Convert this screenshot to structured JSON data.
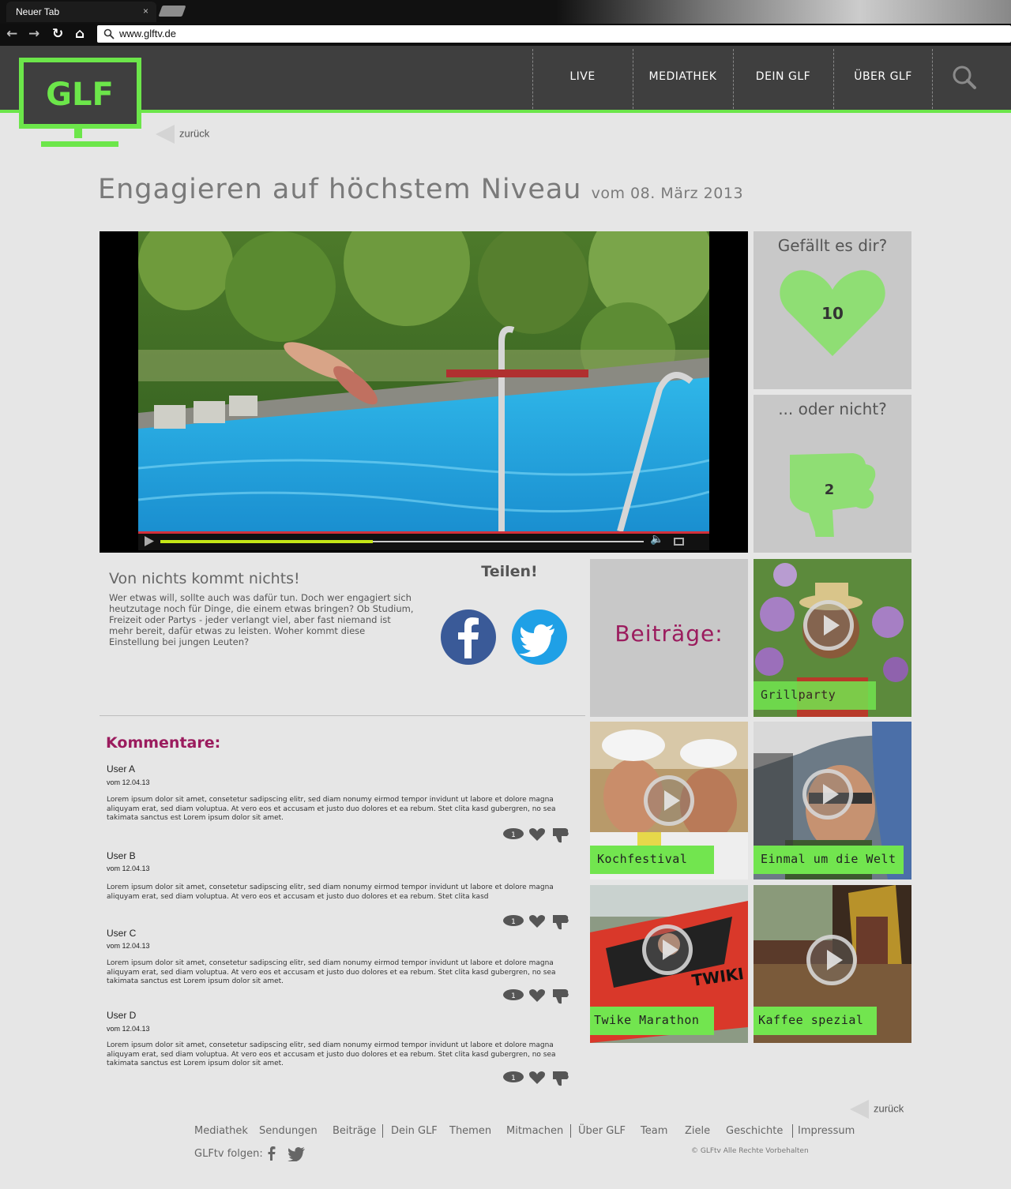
{
  "browser": {
    "tab_title": "Neuer Tab",
    "tab_close": "×",
    "url": "www.glftv.de"
  },
  "site": {
    "logo_text": "GLF",
    "nav": [
      "LIVE",
      "MEDIATHEK",
      "DEIN GLF",
      "ÜBER GLF"
    ],
    "back_label": "zurück",
    "accent_color": "#6ce64a",
    "header_color": "#3f3f3f",
    "comment_heading_color": "#9b1c5e"
  },
  "article": {
    "title": "Engagieren auf höchstem Niveau",
    "date": "vom 08. März 2013",
    "video_progress": 0.44
  },
  "rating": {
    "like_question": "Gefällt es dir?",
    "like_count": "10",
    "dislike_question": "... oder nicht?",
    "dislike_count": "2"
  },
  "description": {
    "heading": "Von nichts kommt nichts!",
    "text": "Wer etwas will, sollte auch was dafür tun. Doch wer engagiert sich heutzutage noch für Dinge, die einem etwas bringen? Ob Studium, Freizeit oder Partys - jeder verlangt viel, aber fast niemand ist mehr bereit, dafür etwas zu leisten. Woher kommt diese Einstellung bei jungen Leuten?"
  },
  "share": {
    "heading": "Teilen!",
    "icons": [
      "facebook-icon",
      "twitter-icon"
    ]
  },
  "beitraege": {
    "heading": "Beiträge:",
    "tiles": [
      "Grillparty",
      "Kochfestival",
      "Einmal um die Welt",
      "Twike Marathon",
      "Kaffee spezial"
    ]
  },
  "comments": {
    "heading": "Kommentare:",
    "items": [
      {
        "user": "User A",
        "date": "vom 12.04.13",
        "text": "Lorem ipsum dolor sit amet, consetetur sadipscing elitr, sed diam nonumy eirmod tempor invidunt ut labore et dolore magna aliquyam erat, sed diam voluptua. At vero eos et accusam et justo duo dolores et ea rebum. Stet clita kasd gubergren, no sea takimata sanctus est Lorem ipsum dolor sit amet.",
        "count": "1"
      },
      {
        "user": "User B",
        "date": "vom 12.04.13",
        "text": "Lorem ipsum dolor sit amet, consetetur sadipscing elitr, sed diam nonumy eirmod tempor invidunt ut labore et dolore magna aliquyam erat, sed diam voluptua. At vero eos et accusam et justo duo dolores et ea rebum. Stet clita kasd",
        "count": "1"
      },
      {
        "user": "User C",
        "date": "vom 12.04.13",
        "text": "Lorem ipsum dolor sit amet, consetetur sadipscing elitr, sed diam nonumy eirmod tempor invidunt ut labore et dolore magna aliquyam erat, sed diam voluptua. At vero eos et accusam et justo duo dolores et ea rebum. Stet clita kasd gubergren, no sea takimata sanctus est Lorem ipsum dolor sit amet.",
        "count": "1"
      },
      {
        "user": "User D",
        "date": "vom 12.04.13",
        "text": "Lorem ipsum dolor sit amet, consetetur sadipscing elitr, sed diam nonumy eirmod tempor invidunt ut labore et dolore magna aliquyam erat, sed diam voluptua. At vero eos et accusam et justo duo dolores et ea rebum. Stet clita kasd gubergren, no sea takimata sanctus est Lorem ipsum dolor sit amet.",
        "count": "1"
      }
    ]
  },
  "footer": {
    "links": [
      "Mediathek",
      "Sendungen",
      "Beiträge",
      "Dein GLF",
      "Themen",
      "Mitmachen",
      "Über GLF",
      "Team",
      "Ziele",
      "Geschichte",
      "Impressum"
    ],
    "follow_label": "GLFtv folgen:",
    "copyright": "© GLFtv Alle Rechte Vorbehalten"
  }
}
